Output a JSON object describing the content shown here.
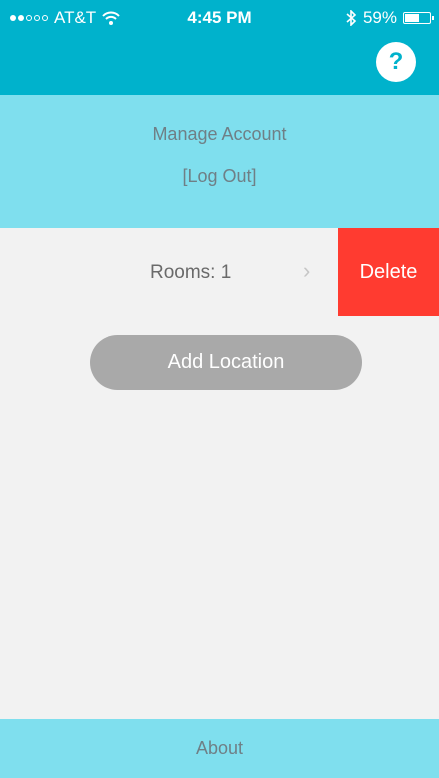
{
  "status_bar": {
    "carrier": "AT&T",
    "time": "4:45 PM",
    "battery_percent": "59%",
    "signal_bars_filled": 2,
    "signal_bars_total": 5,
    "battery_level": 0.59
  },
  "header": {
    "help_label": "?"
  },
  "account": {
    "manage_label": "Manage Account",
    "logout_label": "[Log Out]"
  },
  "location_row": {
    "rooms_label": "Rooms: 1",
    "chevron": "›",
    "delete_label": "Delete"
  },
  "add_location_label": "Add Location",
  "footer": {
    "about_label": "About"
  },
  "colors": {
    "header_bg": "#00b2cc",
    "panel_bg": "#7fdfee",
    "delete_bg": "#ff3b30",
    "button_bg": "#a9a9a9"
  }
}
